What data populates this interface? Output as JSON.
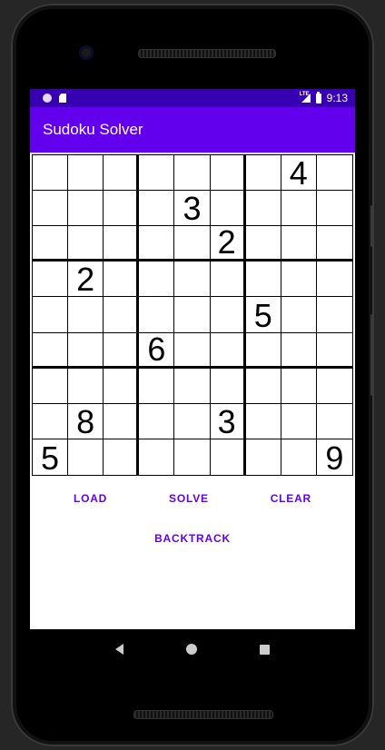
{
  "status_bar": {
    "time": "9:13",
    "network": "LTE"
  },
  "app_bar": {
    "title": "Sudoku Solver"
  },
  "board": [
    [
      "",
      "",
      "",
      "",
      "",
      "",
      "",
      "4",
      ""
    ],
    [
      "",
      "",
      "",
      "",
      "3",
      "",
      "",
      "",
      ""
    ],
    [
      "",
      "",
      "",
      "",
      "",
      "2",
      "",
      "",
      ""
    ],
    [
      "",
      "2",
      "",
      "",
      "",
      "",
      "",
      "",
      ""
    ],
    [
      "",
      "",
      "",
      "",
      "",
      "",
      "5",
      "",
      ""
    ],
    [
      "",
      "",
      "",
      "6",
      "",
      "",
      "",
      "",
      ""
    ],
    [
      "",
      "",
      "",
      "",
      "",
      "",
      "",
      "",
      ""
    ],
    [
      "",
      "8",
      "",
      "",
      "",
      "3",
      "",
      "",
      ""
    ],
    [
      "5",
      "",
      "",
      "",
      "",
      "",
      "",
      "",
      "9"
    ]
  ],
  "buttons": {
    "load": "LOAD",
    "solve": "SOLVE",
    "clear": "CLEAR",
    "backtrack": "BACKTRACK"
  },
  "colors": {
    "status_bar": "#3700b3",
    "app_bar": "#6200ee",
    "button_text": "#6200ee"
  },
  "nav_icons": [
    "back-icon",
    "home-icon",
    "recents-icon"
  ]
}
